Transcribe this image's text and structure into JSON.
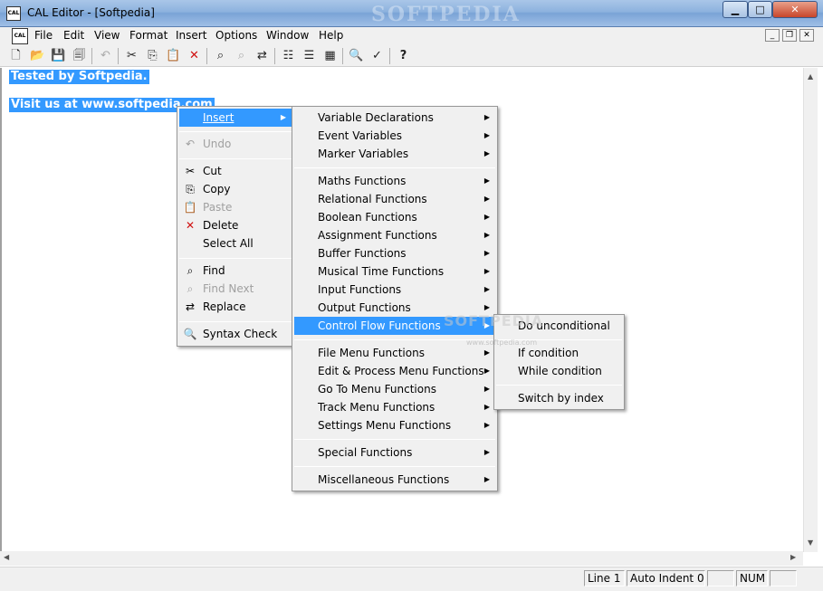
{
  "window": {
    "title": "CAL Editor - [Softpedia]",
    "watermark": "SOFTPEDIA",
    "app_icon_text": "CAL",
    "controls": {
      "minimize": "▁",
      "maximize": "□",
      "close": "✕"
    }
  },
  "menubar": {
    "items": [
      "File",
      "Edit",
      "View",
      "Format",
      "Insert",
      "Options",
      "Window",
      "Help"
    ],
    "mdi_controls": {
      "minimize": "_",
      "restore": "❐",
      "close": "✕"
    }
  },
  "toolbar": {
    "icons": [
      "new-icon",
      "open-icon",
      "save-icon",
      "save-all-icon",
      "undo-icon",
      "cut-icon",
      "copy-icon",
      "paste-icon",
      "delete-icon",
      "find-icon",
      "find-next-icon",
      "replace-icon",
      "indent-icon",
      "outdent-icon",
      "comment-icon",
      "magnifier-icon",
      "syntax-check-icon",
      "help-icon"
    ]
  },
  "editor": {
    "lines": [
      "Tested by Softpedia.",
      "Visit us at www.softpedia.com"
    ]
  },
  "context_menu": {
    "items": [
      {
        "label": "Insert",
        "icon": "",
        "state": "highlighted",
        "submenu": true
      },
      {
        "label": "Undo",
        "icon": "undo-icon",
        "state": "disabled"
      },
      {
        "label": "Cut",
        "icon": "cut-icon",
        "state": "normal"
      },
      {
        "label": "Copy",
        "icon": "copy-icon",
        "state": "normal"
      },
      {
        "label": "Paste",
        "icon": "paste-icon",
        "state": "disabled"
      },
      {
        "label": "Delete",
        "icon": "delete-icon",
        "state": "normal"
      },
      {
        "label": "Select All",
        "icon": "",
        "state": "normal"
      },
      {
        "label": "Find",
        "icon": "find-icon",
        "state": "normal"
      },
      {
        "label": "Find Next",
        "icon": "find-next-icon",
        "state": "disabled"
      },
      {
        "label": "Replace",
        "icon": "replace-icon",
        "state": "normal"
      },
      {
        "label": "Syntax Check",
        "icon": "syntax-check-icon",
        "state": "normal"
      }
    ]
  },
  "insert_submenu": {
    "items": [
      "Variable Declarations",
      "Event Variables",
      "Marker Variables",
      "Maths Functions",
      "Relational Functions",
      "Boolean Functions",
      "Assignment Functions",
      "Buffer Functions",
      "Musical Time Functions",
      "Input Functions",
      "Output Functions",
      "Control Flow Functions",
      "File Menu Functions",
      "Edit & Process Menu Functions",
      "Go To Menu Functions",
      "Track Menu Functions",
      "Settings Menu Functions",
      "Special Functions",
      "Miscellaneous Functions"
    ],
    "highlighted": "Control Flow Functions"
  },
  "control_flow_submenu": {
    "items": [
      "Do unconditional",
      "If condition",
      "While condition",
      "Switch by index"
    ]
  },
  "overlay_watermark": {
    "big": "SOFTPEDIA",
    "small": "www.softpedia.com"
  },
  "statusbar": {
    "line": "Line 1",
    "indent": "Auto Indent 0",
    "blank": "",
    "num": "NUM"
  }
}
